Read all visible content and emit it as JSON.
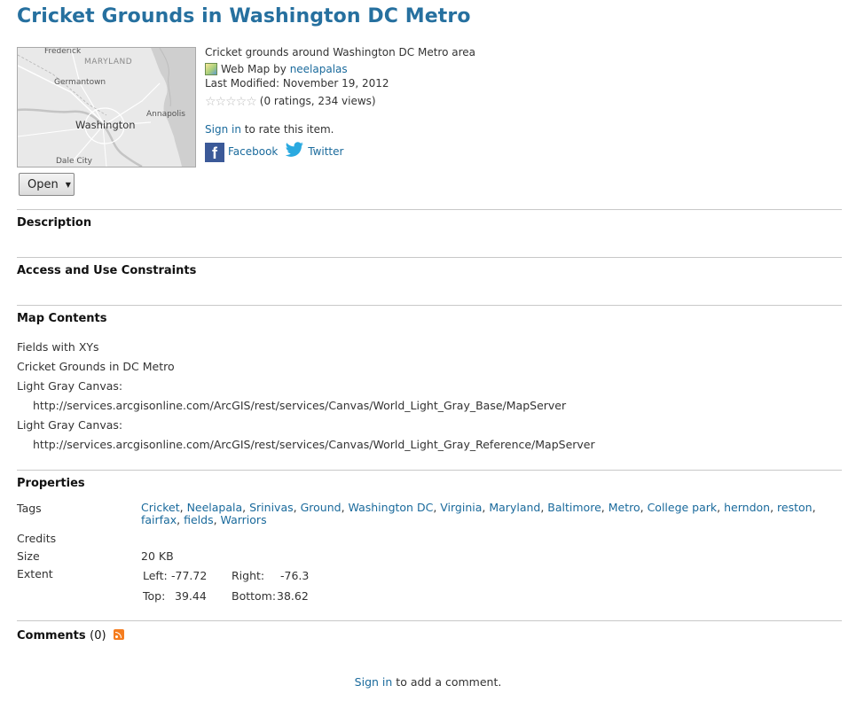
{
  "item": {
    "title": "Cricket Grounds in Washington DC Metro",
    "summary": "Cricket grounds around Washington DC Metro area",
    "type_label": "Web Map",
    "by_label": "by",
    "owner": "neelapalas",
    "last_modified": "Last Modified: November 19, 2012",
    "ratings_text": "(0 ratings, 234 views)",
    "rating_value": 0,
    "rating_max": 5,
    "sign_in_label": "Sign in",
    "rate_text": "to rate this item.",
    "facebook_label": "Facebook",
    "twitter_label": "Twitter",
    "open_label": "Open"
  },
  "thumbnail": {
    "labels": {
      "frederick": "Frederick",
      "maryland": "MARYLAND",
      "germantown": "Germantown",
      "annapolis": "Annapolis",
      "washington": "Washington",
      "dale_city": "Dale City"
    },
    "colors": {
      "land": "#e9e9e9",
      "water": "#c9c9c9",
      "roads": "#ffffff"
    }
  },
  "sections": {
    "description": "Description",
    "access": "Access and Use Constraints",
    "map_contents": "Map Contents",
    "properties": "Properties",
    "comments": "Comments",
    "comments_count": "(0)"
  },
  "map_contents": {
    "layer1": "Fields with XYs",
    "layer2": "Cricket Grounds in DC Metro",
    "basemap1_label": "Light Gray Canvas:",
    "basemap1_url": "http://services.arcgisonline.com/ArcGIS/rest/services/Canvas/World_Light_Gray_Base/MapServer",
    "basemap2_label": "Light Gray Canvas:",
    "basemap2_url": "http://services.arcgisonline.com/ArcGIS/rest/services/Canvas/World_Light_Gray_Reference/MapServer"
  },
  "properties": {
    "tags_label": "Tags",
    "tags": [
      "Cricket",
      "Neelapala",
      "Srinivas",
      "Ground",
      "Washington DC",
      "Virginia",
      "Maryland",
      "Baltimore",
      "Metro",
      "College park",
      "herndon",
      "reston",
      "fairfax",
      "fields",
      "Warriors"
    ],
    "credits_label": "Credits",
    "size_label": "Size",
    "size_value": "20 KB",
    "extent_label": "Extent",
    "extent": {
      "left_label": "Left:",
      "left": "-77.72",
      "right_label": "Right:",
      "right": "-76.3",
      "top_label": "Top:",
      "top": "39.44",
      "bottom_label": "Bottom:",
      "bottom": "38.62"
    }
  },
  "footer": {
    "sign_in_label": "Sign in",
    "add_comment_text": "to add a comment."
  },
  "colors": {
    "title": "#26709f",
    "link": "#1a6a9c",
    "rule": "#c8c8c8",
    "rss": "#f57d1f",
    "facebook": "#3b5998",
    "twitter": "#2aa9e0"
  }
}
